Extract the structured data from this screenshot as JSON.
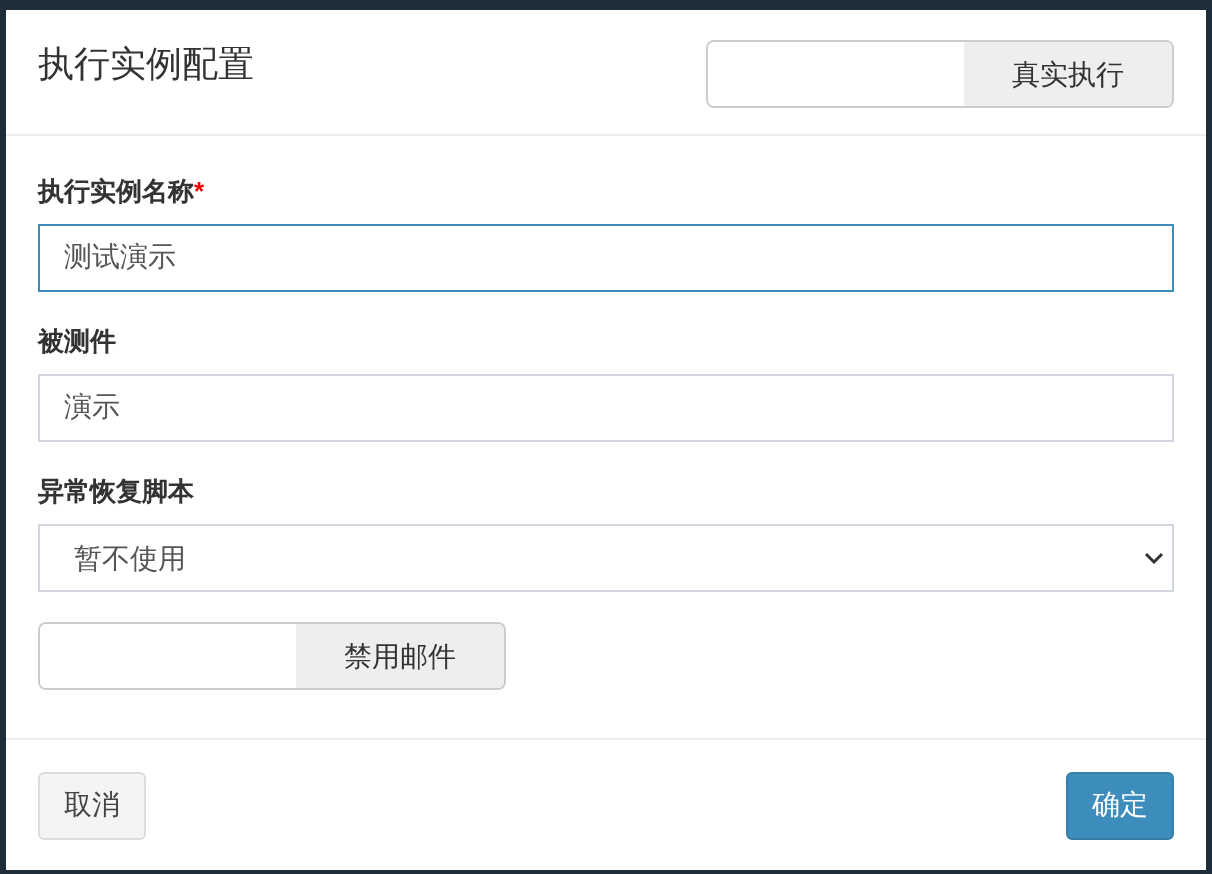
{
  "dialog": {
    "title": "执行实例配置",
    "header_toggle": {
      "label": "真实执行",
      "on": false
    },
    "fields": [
      {
        "kind": "text",
        "label": "执行实例名称",
        "required_mark": "*",
        "value": "测试演示",
        "focused": true
      },
      {
        "kind": "text",
        "label": "被测件",
        "value": "演示",
        "focused": false
      },
      {
        "kind": "select",
        "label": "异常恢复脚本",
        "value": "暂不使用"
      }
    ],
    "toggle": {
      "label": "禁用邮件",
      "on": false
    },
    "buttons": [
      {
        "kind": "default",
        "label": "取消"
      },
      {
        "kind": "primary",
        "label": "确定"
      }
    ]
  }
}
